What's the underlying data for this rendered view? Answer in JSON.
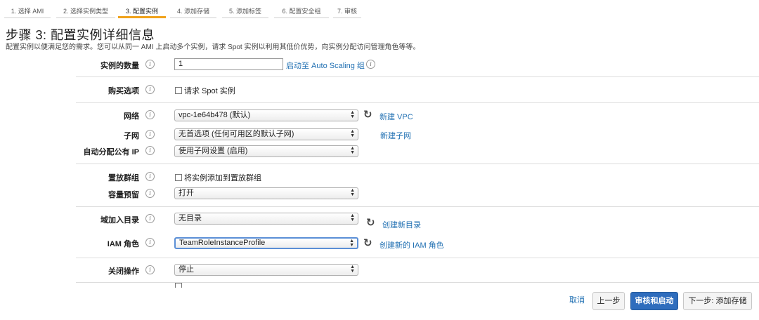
{
  "wizard": {
    "steps": [
      "1. 选择 AMI",
      "2. 选择实例类型",
      "3. 配置实例",
      "4. 添加存储",
      "5. 添加标签",
      "6. 配置安全组",
      "7. 审核"
    ],
    "active_step": 2
  },
  "header": {
    "title": "步骤 3: 配置实例详细信息",
    "subtitle": "配置实例以便满足您的需求。您可以从同一 AMI 上启动多个实例，请求 Spot 实例以利用其低价优势，向实例分配访问管理角色等等。"
  },
  "form": {
    "instance_count": {
      "label": "实例的数量",
      "value": "1",
      "link": "启动至 Auto Scaling 组"
    },
    "purchase_option": {
      "label": "购买选项",
      "checkbox_label": "请求 Spot 实例"
    },
    "network": {
      "label": "网络",
      "value": "vpc-1e64b478 (默认)",
      "link": "新建 VPC"
    },
    "subnet": {
      "label": "子网",
      "value": "无首选项 (任何可用区的默认子网)",
      "link": "新建子网"
    },
    "auto_public_ip": {
      "label": "自动分配公有 IP",
      "value": "使用子网设置 (启用)"
    },
    "placement_group": {
      "label": "置放群组",
      "checkbox_label": "将实例添加到置放群组"
    },
    "capacity_reservation": {
      "label": "容量预留",
      "value": "打开"
    },
    "domain_join": {
      "label": "域加入目录",
      "value": "无目录",
      "link": "创建新目录"
    },
    "iam_role": {
      "label": "IAM 角色",
      "value": "TeamRoleInstanceProfile",
      "link": "创建新的 IAM 角色"
    },
    "shutdown_behavior": {
      "label": "关闭操作",
      "value": "停止"
    }
  },
  "footer": {
    "cancel": "取消",
    "previous": "上一步",
    "review_launch": "审核和启动",
    "next": "下一步: 添加存储"
  },
  "icons": {
    "info": "info-icon",
    "refresh": "refresh-icon",
    "select_arrows": "updown-arrows-icon"
  },
  "colors": {
    "link": "#1f6fb2",
    "active_tab": "#f0a21a",
    "primary_button": "#2f6dbd"
  }
}
